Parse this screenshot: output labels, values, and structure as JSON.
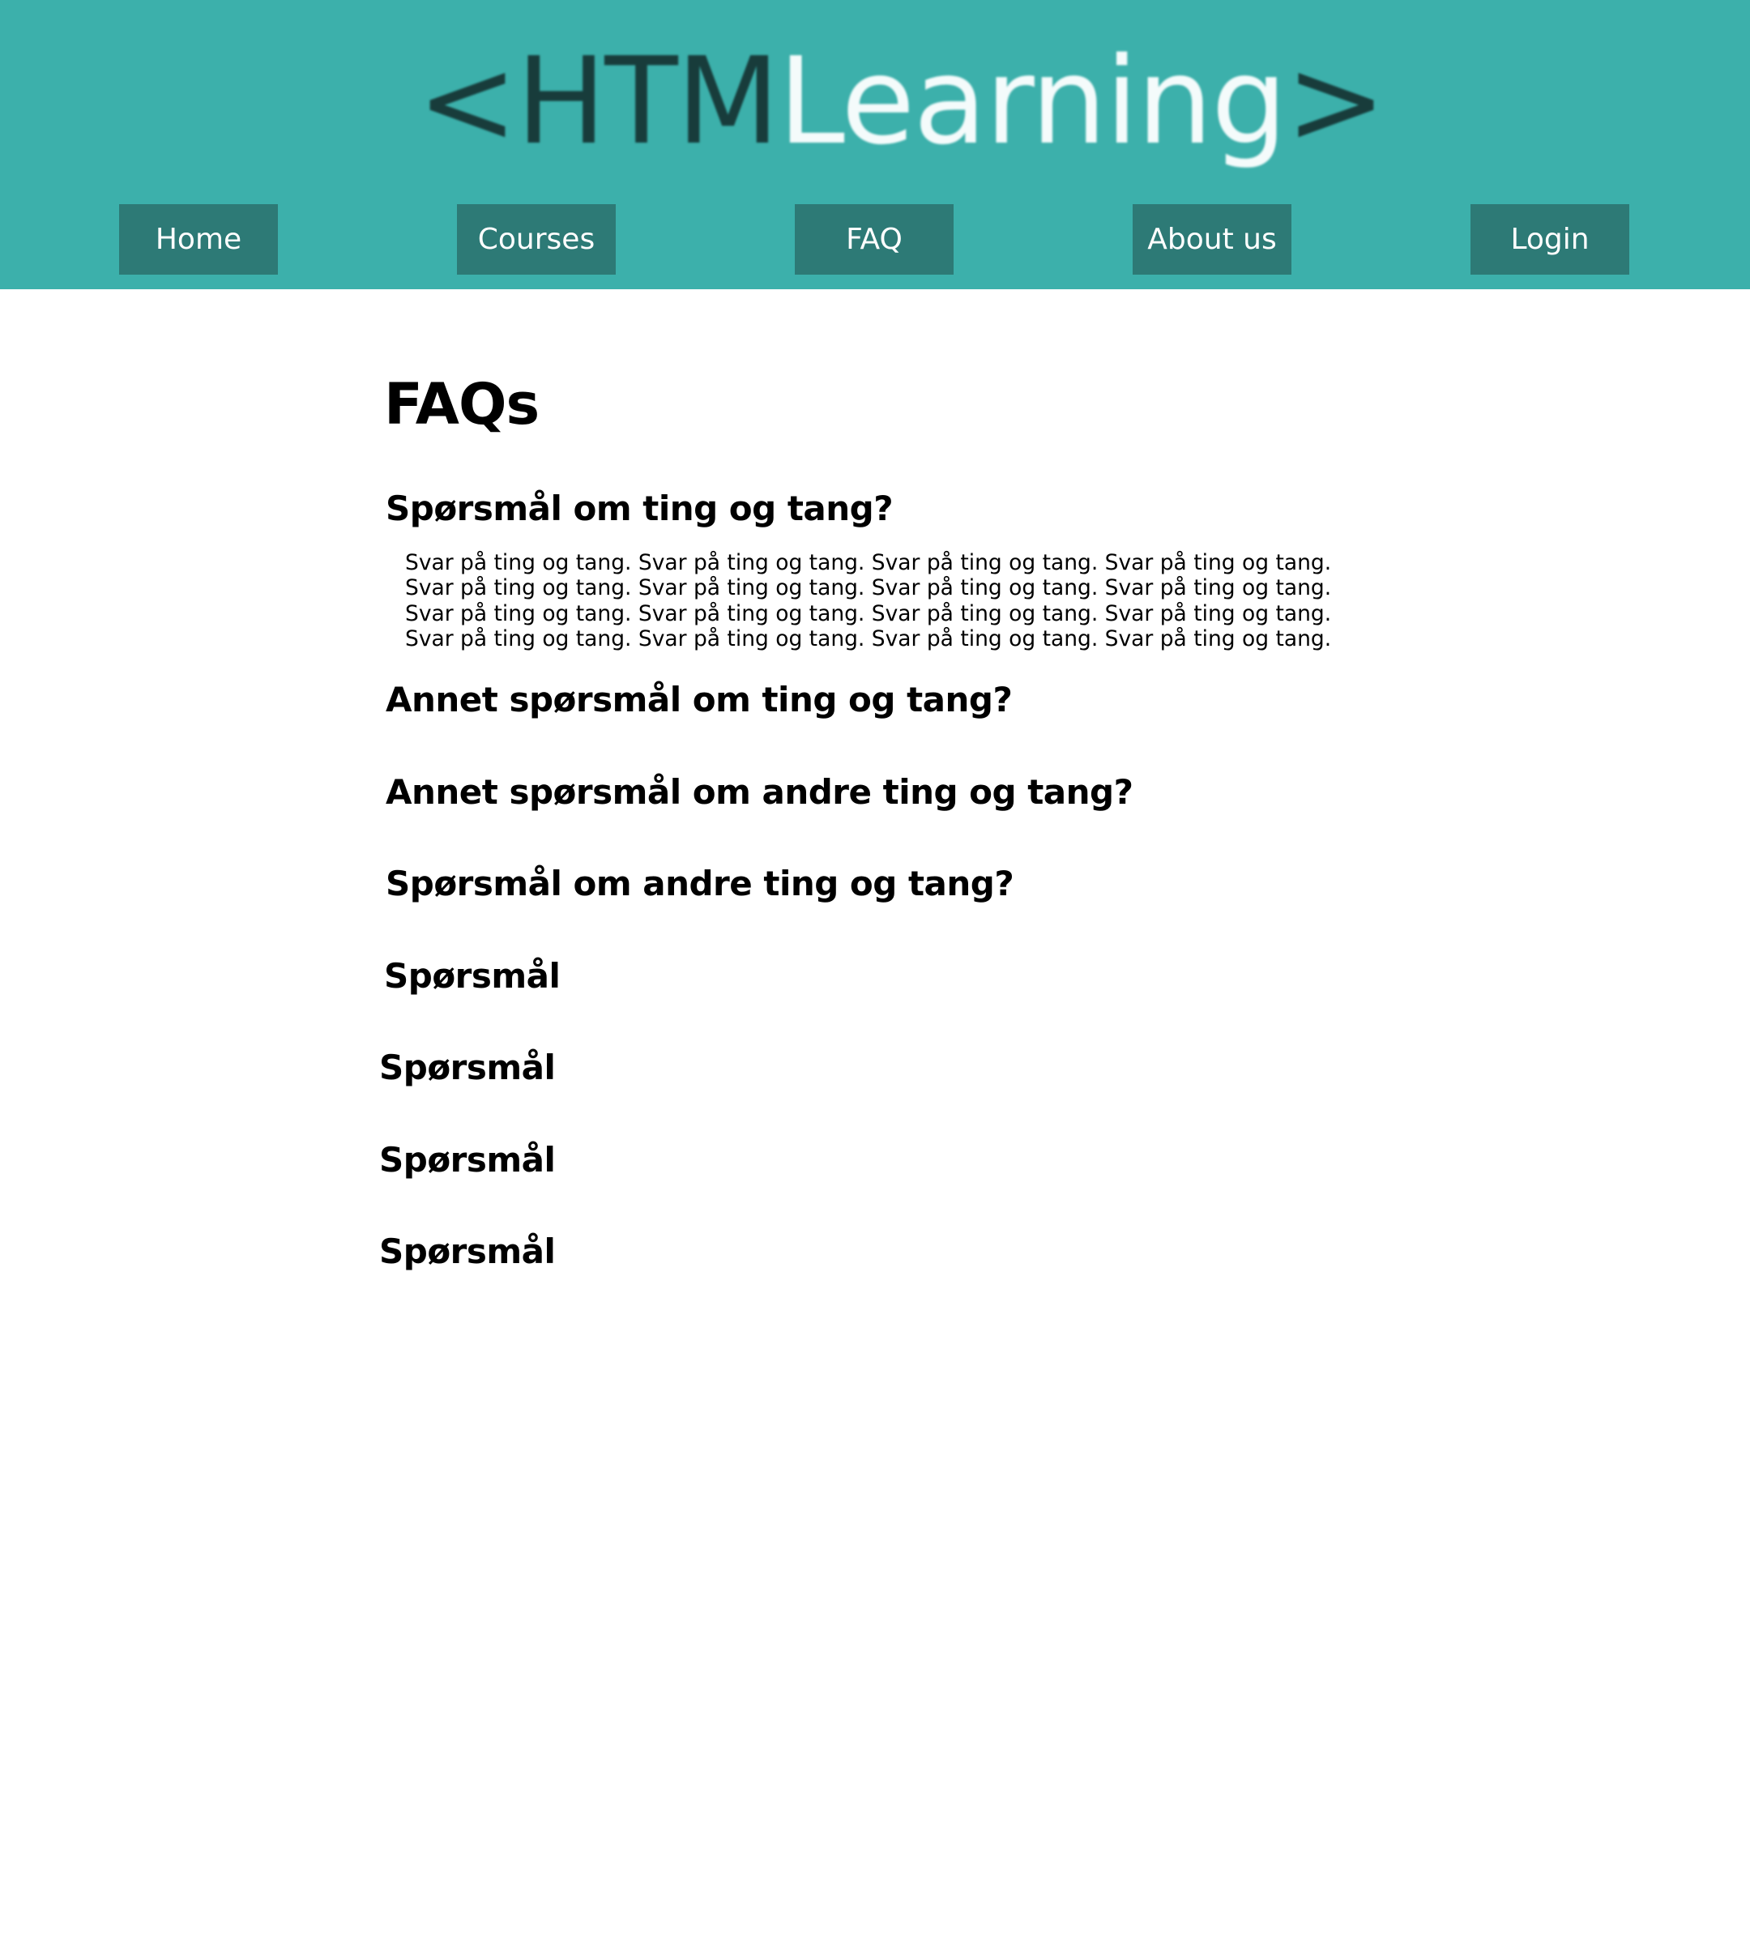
{
  "header": {
    "logo": {
      "open_bracket": "<",
      "part_dark": "HTM",
      "part_light": "Learning",
      "close_bracket": ">"
    },
    "nav": {
      "home": "Home",
      "courses": "Courses",
      "faq": "FAQ",
      "about": "About us",
      "login": "Login"
    }
  },
  "colors": {
    "header_bg": "#3cb0ab",
    "nav_button_bg": "#2d7a76",
    "logo_dark": "#183c3b",
    "logo_light": "#f4fbfb"
  },
  "main": {
    "title": "FAQs",
    "faqs": [
      {
        "question": "Spørsmål om ting og tang?",
        "answer_lines": [
          "Svar på ting og tang. Svar på ting og tang. Svar på ting og tang. Svar på ting og tang.",
          "Svar på ting og tang. Svar på ting og tang. Svar på ting og tang. Svar på ting og tang.",
          "Svar på ting og tang. Svar på ting og tang. Svar på ting og tang. Svar på ting og tang.",
          "Svar på ting og tang. Svar på ting og tang. Svar på ting og tang. Svar på ting og tang."
        ]
      },
      {
        "question": "Annet spørsmål om ting og tang?"
      },
      {
        "question": "Annet spørsmål om andre ting og tang?"
      },
      {
        "question": "Spørsmål om andre ting og tang?"
      },
      {
        "question": "Spørsmål"
      },
      {
        "question": "Spørsmål"
      },
      {
        "question": "Spørsmål"
      },
      {
        "question": "Spørsmål"
      }
    ]
  }
}
